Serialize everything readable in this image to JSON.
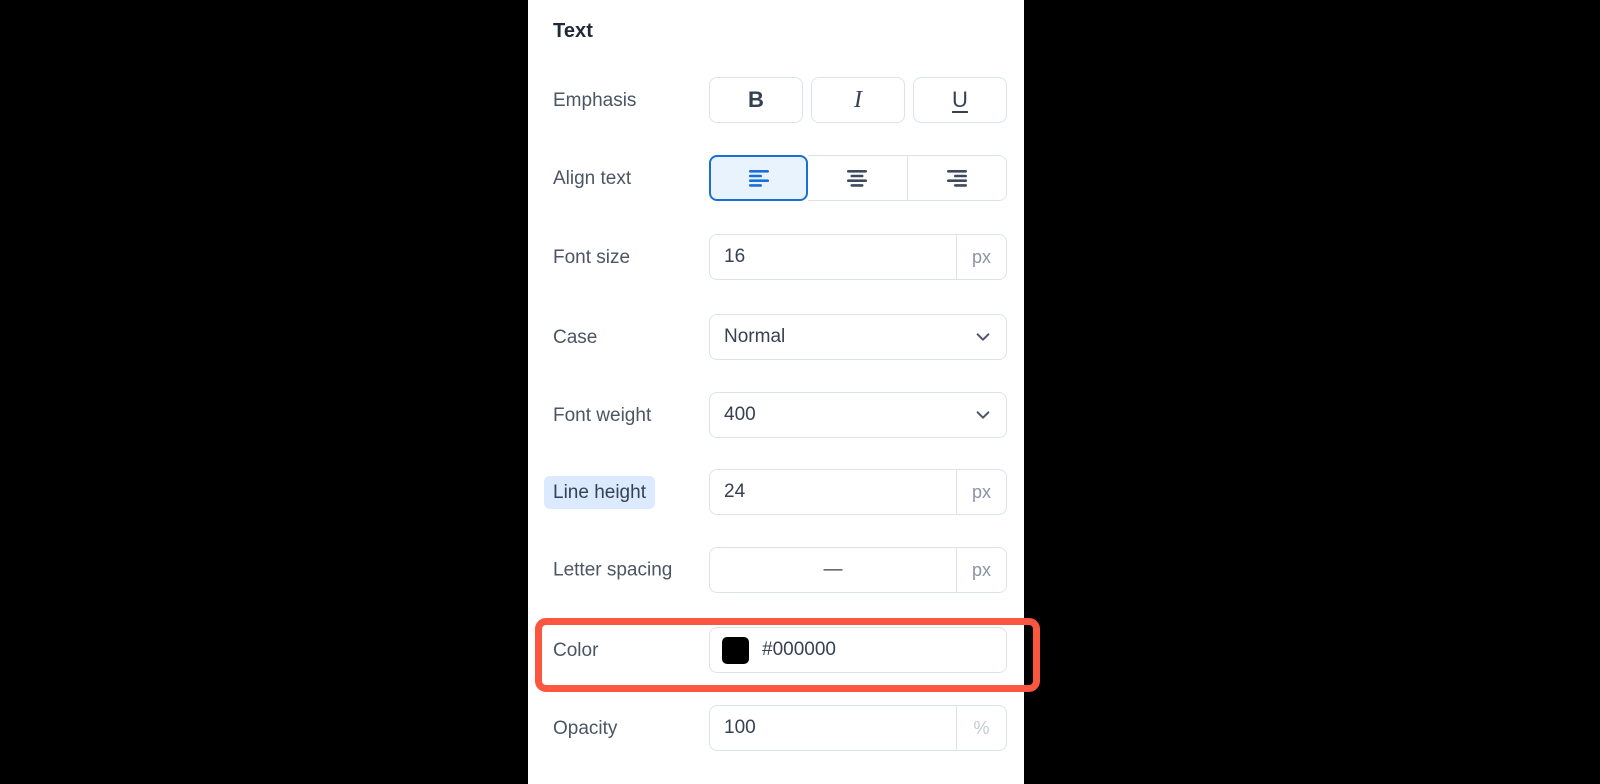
{
  "panel": {
    "title": "Text",
    "rows": [
      {
        "label": "Emphasis",
        "type": "emphasis",
        "buttons": [
          {
            "label": "B",
            "name": "bold-button"
          },
          {
            "label": "I",
            "name": "italic-button"
          },
          {
            "label": "U",
            "name": "underline-button"
          }
        ]
      },
      {
        "label": "Align text",
        "type": "align",
        "options": [
          {
            "name": "align-left-icon",
            "selected": true
          },
          {
            "name": "align-center-icon",
            "selected": false
          },
          {
            "name": "align-right-icon",
            "selected": false
          }
        ]
      },
      {
        "label": "Font size",
        "type": "input",
        "value": "16",
        "unit": "px"
      },
      {
        "label": "Case",
        "type": "select",
        "value": "Normal"
      },
      {
        "label": "Font weight",
        "type": "select",
        "value": "400"
      },
      {
        "label": "Line height",
        "type": "input",
        "value": "24",
        "unit": "px",
        "label_highlighted": true
      },
      {
        "label": "Letter spacing",
        "type": "input",
        "value": "—",
        "unit": "px",
        "centered": true
      },
      {
        "label": "Color",
        "type": "color",
        "value": "#000000",
        "swatch": "#000000"
      },
      {
        "label": "Opacity",
        "type": "input",
        "value": "100",
        "unit": "%",
        "unit_muted": true
      }
    ]
  },
  "annotation": {
    "target": "Color",
    "color": "#fb5640"
  }
}
